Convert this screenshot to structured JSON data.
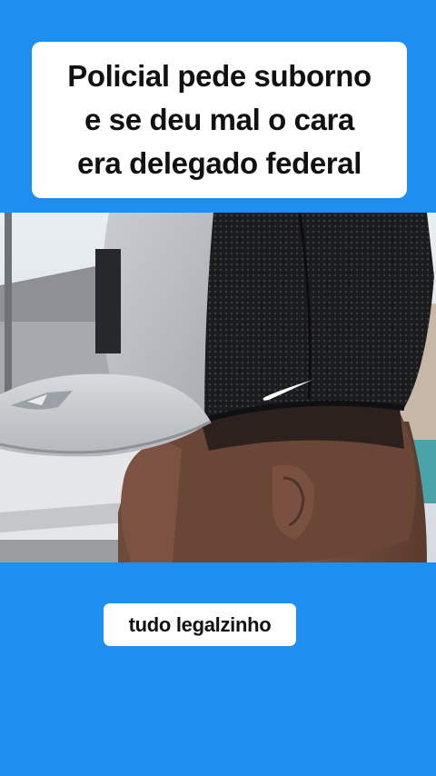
{
  "title_card": {
    "lines": [
      "Policial pede suborno",
      "e se deu mal o cara",
      "era delegado federal"
    ]
  },
  "video": {
    "description_icon": "video-frame-icon"
  },
  "caption": {
    "text": "tudo legalzinho"
  },
  "colors": {
    "background": "#1e8ff0",
    "card": "#ffffff",
    "text": "#111111"
  }
}
